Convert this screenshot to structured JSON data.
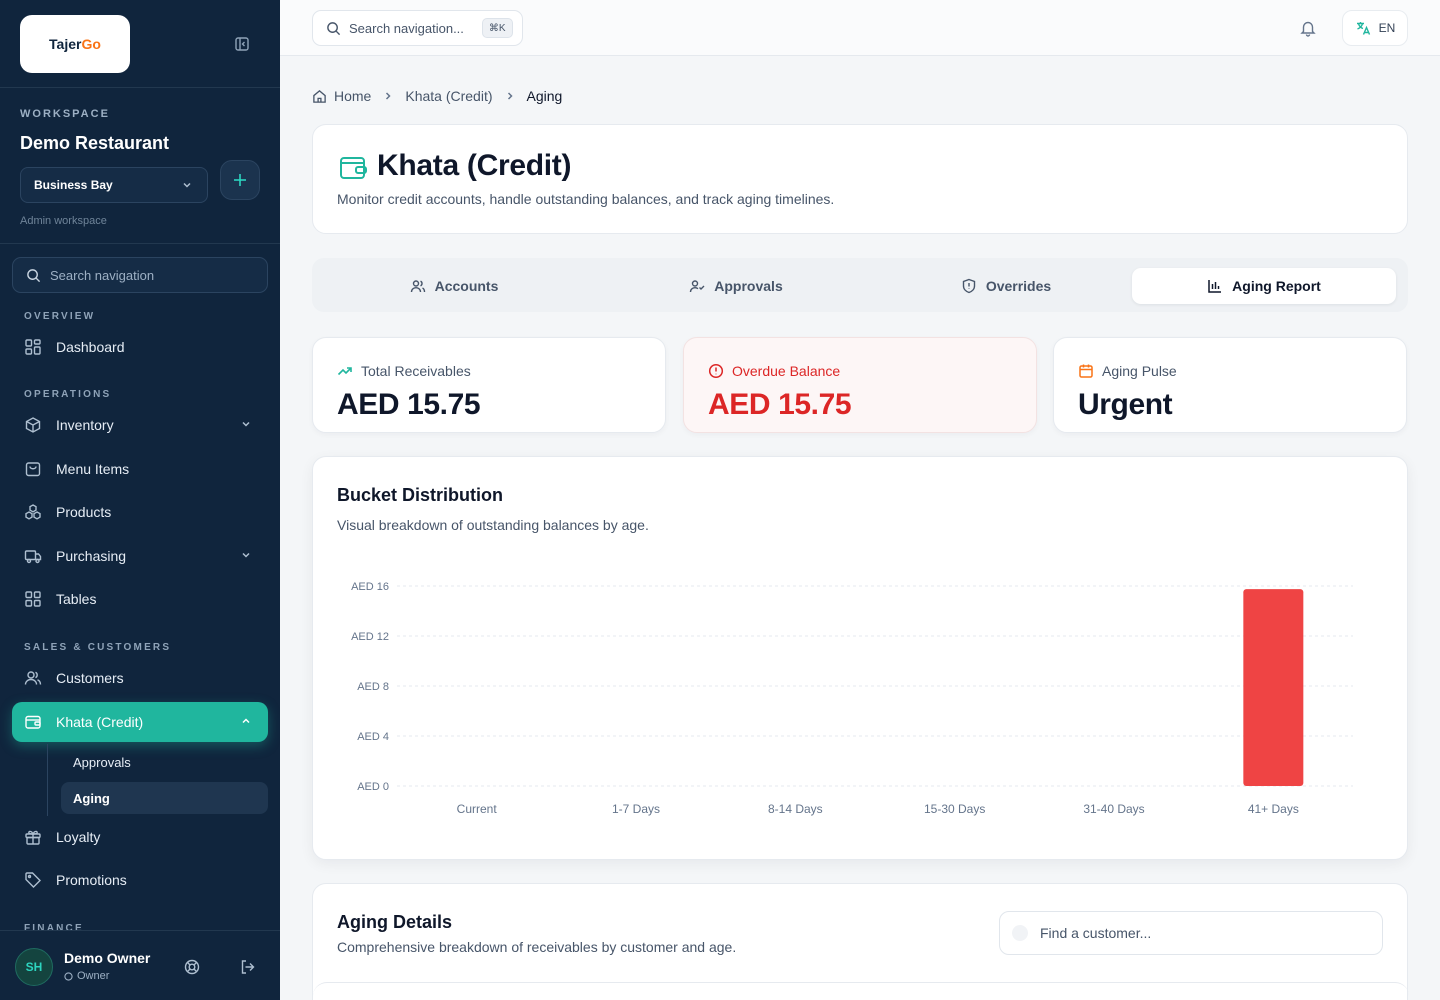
{
  "sidebar": {
    "logo": {
      "part1": "Tajer",
      "part2": "Go"
    },
    "workspace_label": "WORKSPACE",
    "workspace_name": "Demo Restaurant",
    "branch": "Business Bay",
    "workspace_sub": "Admin workspace",
    "search_placeholder": "Search navigation",
    "sections": {
      "overview": "OVERVIEW",
      "operations": "OPERATIONS",
      "sales": "SALES & CUSTOMERS",
      "finance": "FINANCE"
    },
    "items": {
      "dashboard": "Dashboard",
      "inventory": "Inventory",
      "menu_items": "Menu Items",
      "products": "Products",
      "purchasing": "Purchasing",
      "tables": "Tables",
      "customers": "Customers",
      "khata": "Khata (Credit)",
      "approvals": "Approvals",
      "aging": "Aging",
      "loyalty": "Loyalty",
      "promotions": "Promotions"
    },
    "user": {
      "initials": "SH",
      "name": "Demo Owner",
      "role": "Owner"
    }
  },
  "topbar": {
    "search_placeholder": "Search navigation...",
    "shortcut": "⌘K",
    "language": "EN"
  },
  "breadcrumb": {
    "home": "Home",
    "parent": "Khata (Credit)",
    "current": "Aging"
  },
  "header": {
    "title": "Khata (Credit)",
    "subtitle": "Monitor credit accounts, handle outstanding balances, and track aging timelines."
  },
  "tabs": {
    "accounts": "Accounts",
    "approvals": "Approvals",
    "overrides": "Overrides",
    "aging": "Aging Report"
  },
  "stats": {
    "total": {
      "label": "Total Receivables",
      "value": "AED 15.75"
    },
    "overdue": {
      "label": "Overdue Balance",
      "value": "AED 15.75"
    },
    "pulse": {
      "label": "Aging Pulse",
      "value": "Urgent"
    }
  },
  "chart_section": {
    "title": "Bucket Distribution",
    "subtitle": "Visual breakdown of outstanding balances by age."
  },
  "chart_data": {
    "type": "bar",
    "categories": [
      "Current",
      "1-7 Days",
      "8-14 Days",
      "15-30 Days",
      "31-40 Days",
      "41+ Days"
    ],
    "values": [
      0,
      0,
      0,
      0,
      0,
      15.75
    ],
    "ylim": [
      0,
      16
    ],
    "yticks": [
      0,
      4,
      8,
      12,
      16
    ],
    "ytick_labels": [
      "AED 0",
      "AED 4",
      "AED 8",
      "AED 12",
      "AED 16"
    ],
    "bar_color": "#ef4444",
    "grid": true
  },
  "details": {
    "title": "Aging Details",
    "subtitle": "Comprehensive breakdown of receivables by customer and age.",
    "search_placeholder": "Find a customer..."
  }
}
